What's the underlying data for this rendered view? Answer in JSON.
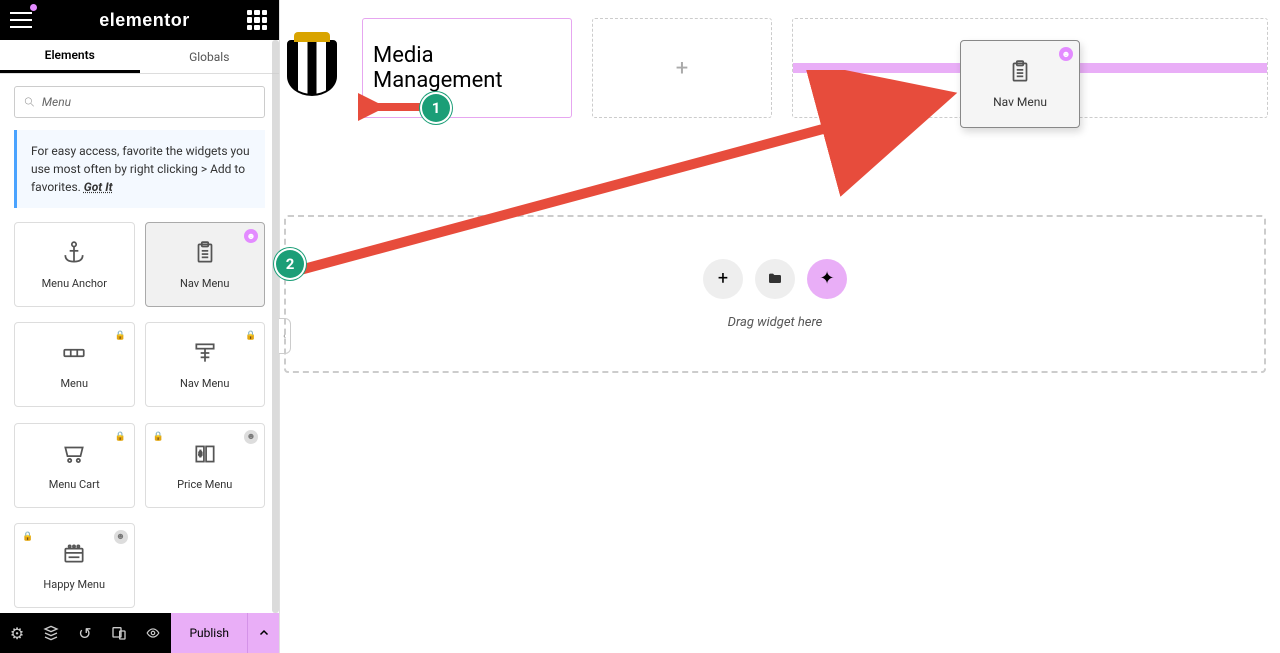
{
  "header": {
    "brand": "elementor"
  },
  "tabs": {
    "elements": "Elements",
    "globals": "Globals"
  },
  "search": {
    "value": "Menu"
  },
  "tip": {
    "text": "For easy access, favorite the widgets you use most often by right clicking > Add to favorites.",
    "gotit": "Got It"
  },
  "widgets": [
    {
      "name": "Menu Anchor"
    },
    {
      "name": "Nav Menu"
    },
    {
      "name": "Menu"
    },
    {
      "name": "Nav Menu"
    },
    {
      "name": "Menu Cart"
    },
    {
      "name": "Price Menu"
    },
    {
      "name": "Happy Menu"
    }
  ],
  "bottombar": {
    "publish": "Publish"
  },
  "canvas": {
    "title": "Media Management",
    "dragging_widget": "Nav Menu",
    "dropzone": "Drag widget here"
  },
  "annotations": {
    "b1": "1",
    "b2": "2"
  }
}
